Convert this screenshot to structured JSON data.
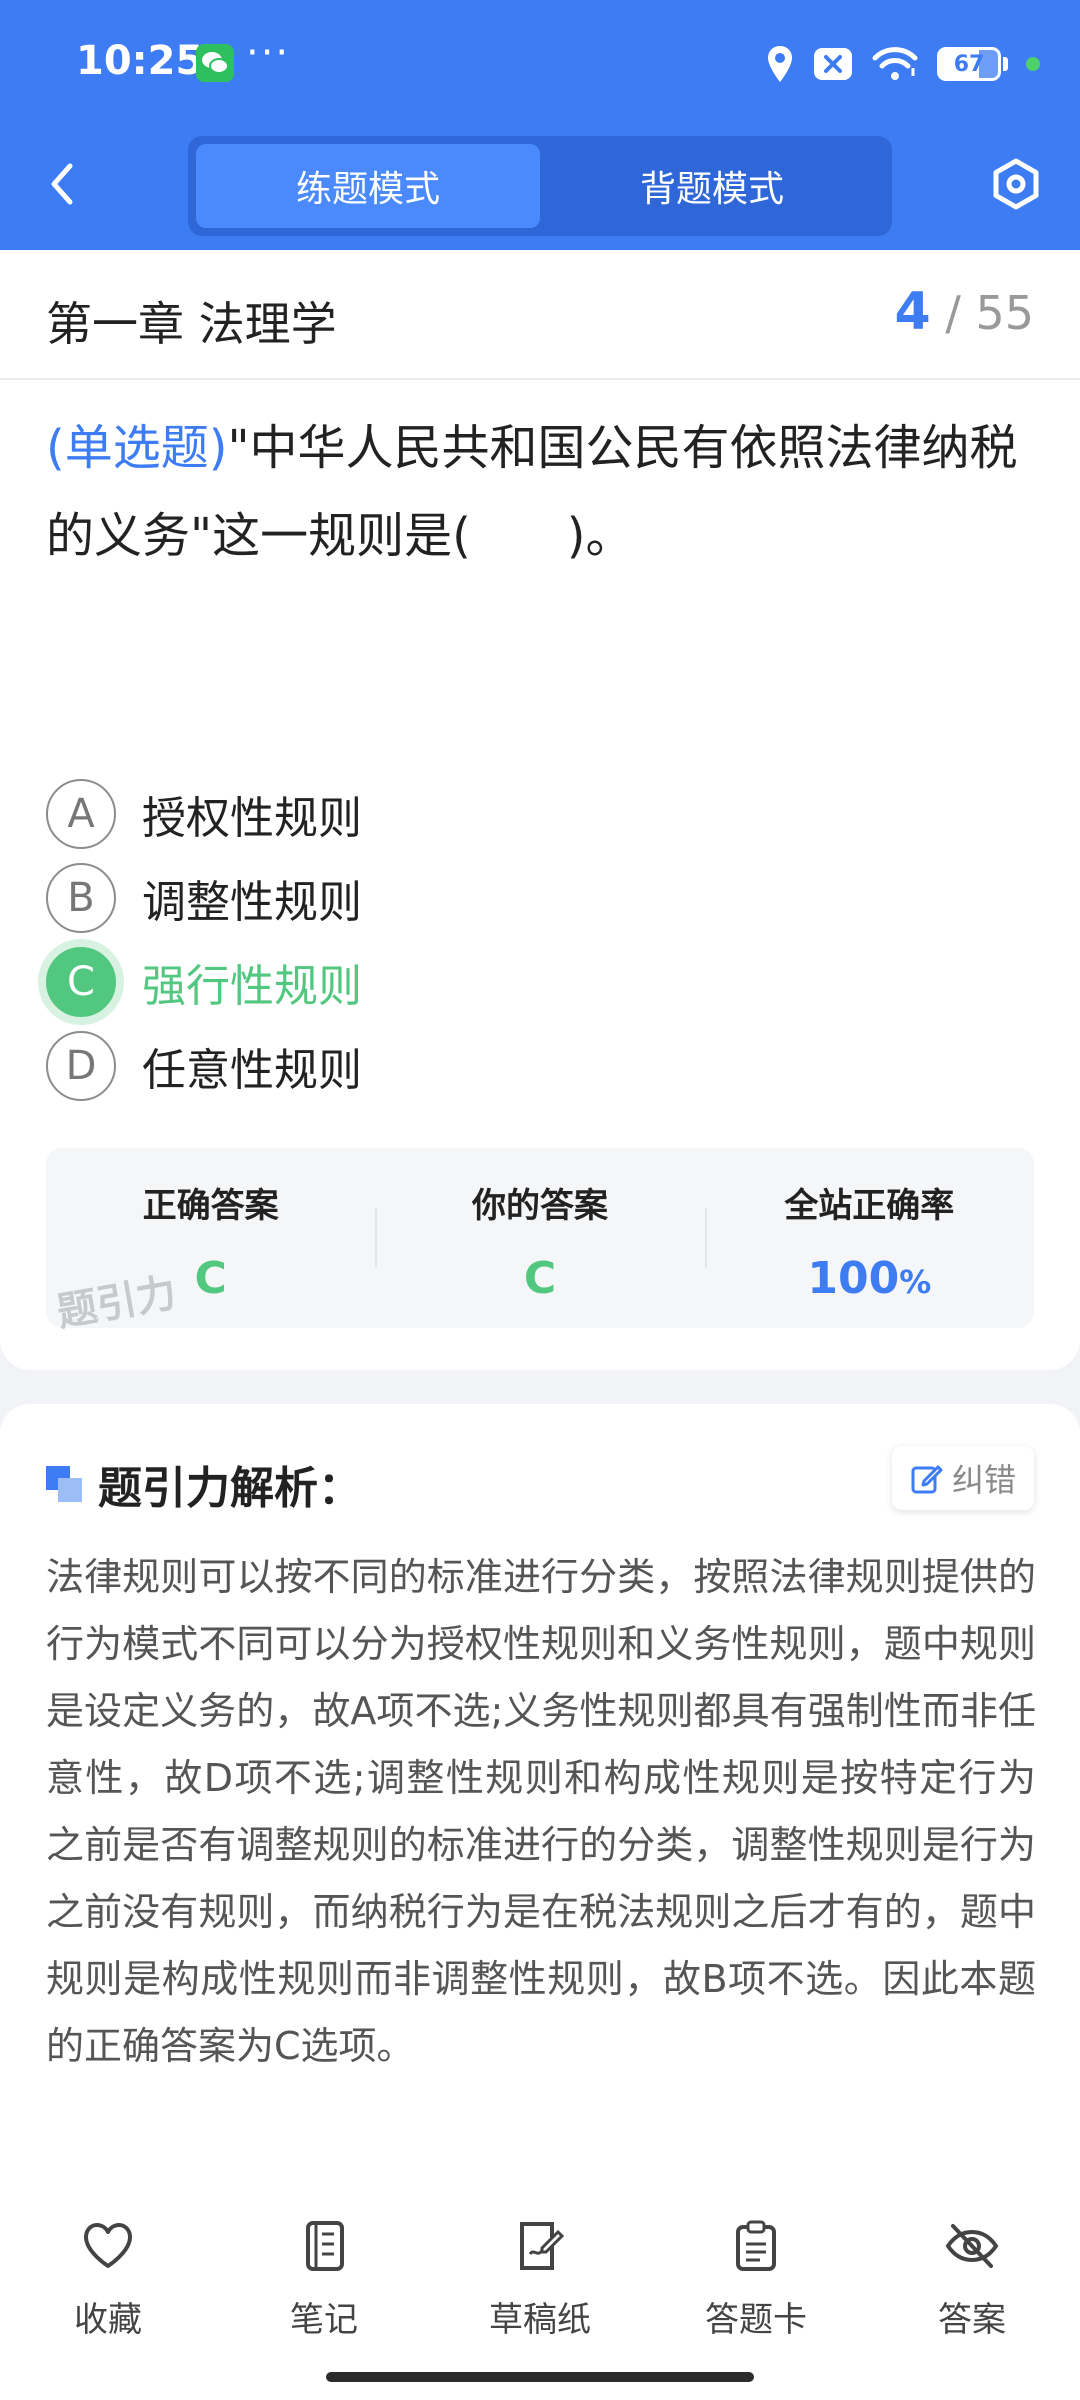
{
  "status_bar": {
    "time": "10:25",
    "more": "···",
    "battery": "67",
    "battery_level": 0.67,
    "icons": [
      "wechat-icon",
      "location-icon",
      "notification-x-icon",
      "wifi-icon",
      "battery-icon"
    ]
  },
  "header": {
    "back_icon": "chevron-left-icon",
    "modes": [
      "练题模式",
      "背题模式"
    ],
    "active_mode": "练题模式",
    "settings_icon": "hexagon-settings-icon",
    "accent_color": "#3e7cf4"
  },
  "chapter": {
    "title": "第一章 法理学",
    "current": "4",
    "separator": "/",
    "total": "55"
  },
  "question": {
    "type": "(单选题)",
    "text": "\"中华人民共和国公民有依照法律纳税的义务\"这一规则是(　　)。",
    "options": [
      {
        "letter": "A",
        "label": "授权性规则"
      },
      {
        "letter": "B",
        "label": "调整性规则"
      },
      {
        "letter": "C",
        "label": "强行性规则"
      },
      {
        "letter": "D",
        "label": "任意性规则"
      }
    ],
    "selected": "C",
    "correct_color": "#52c77f"
  },
  "stats": {
    "correct_label": "正确答案",
    "correct_value": "C",
    "yours_label": "你的答案",
    "yours_value": "C",
    "rate_label": "全站正确率",
    "rate_value": "100",
    "rate_unit": "%",
    "watermark": "题引力"
  },
  "analysis": {
    "title": "题引力解析：",
    "report_label": "纠错",
    "text": "法律规则可以按不同的标准进行分类，按照法律规则提供的行为模式不同可以分为授权性规则和义务性规则，题中规则是设定义务的，故A项不选;义务性规则都具有强制性而非任意性，故D项不选;调整性规则和构成性规则是按特定行为之前是否有调整规则的标准进行的分类，调整性规则是行为之前没有规则，而纳税行为是在税法规则之后才有的，题中规则是构成性规则而非调整性规则，故B项不选。因此本题的正确答案为C选项。"
  },
  "bottom_tabs": [
    {
      "label": "收藏",
      "icon": "heart-icon"
    },
    {
      "label": "笔记",
      "icon": "notebook-icon"
    },
    {
      "label": "草稿纸",
      "icon": "draft-paper-icon"
    },
    {
      "label": "答题卡",
      "icon": "clipboard-icon"
    },
    {
      "label": "答案",
      "icon": "eye-slash-icon"
    }
  ]
}
